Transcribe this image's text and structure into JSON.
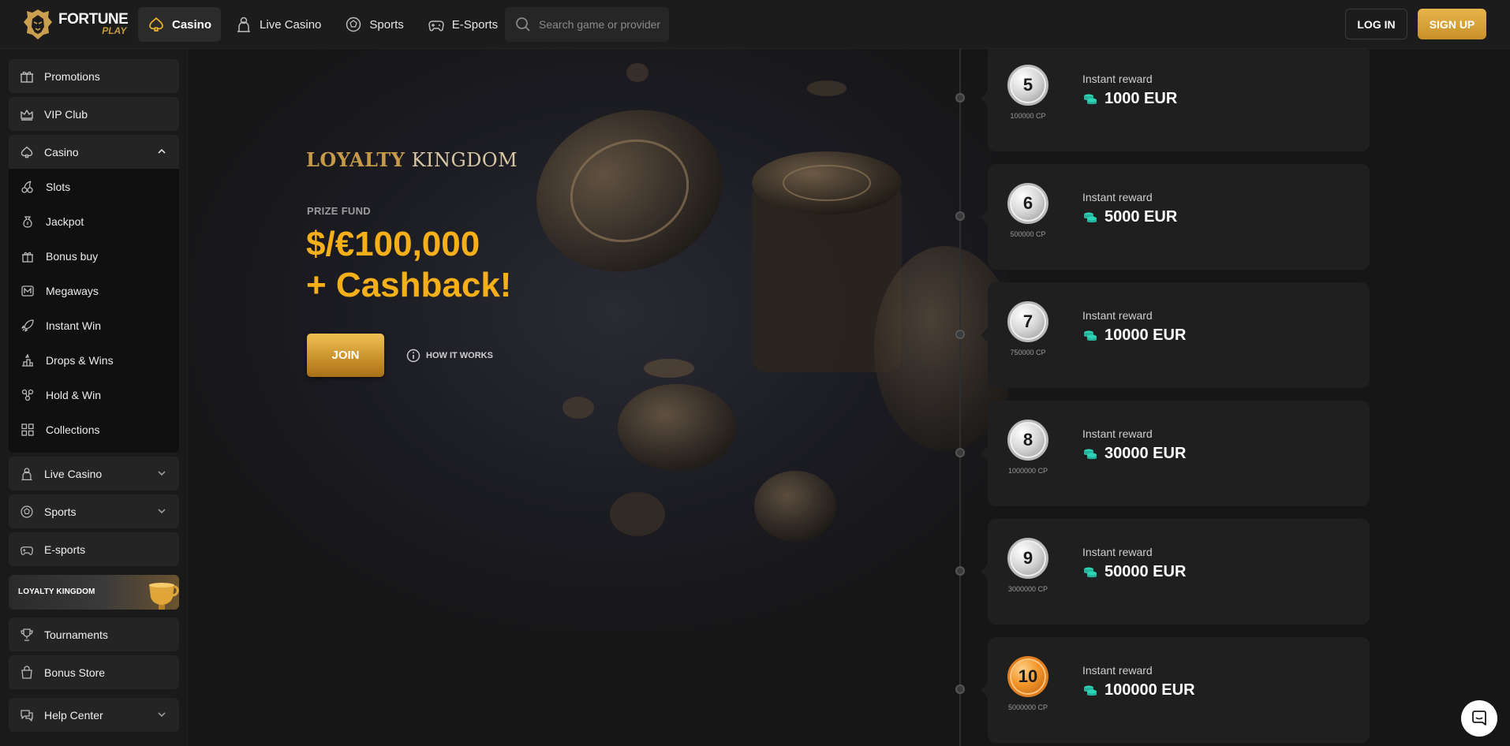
{
  "header": {
    "logo": {
      "line1": "FORTUNE",
      "line2": "PLAY",
      "icon": "lion-head-icon"
    },
    "nav": [
      {
        "label": "Casino",
        "icon": "spade-icon",
        "active": true
      },
      {
        "label": "Live Casino",
        "icon": "dealer-icon",
        "active": false
      },
      {
        "label": "Sports",
        "icon": "soccer-ball-icon",
        "active": false
      },
      {
        "label": "E-Sports",
        "icon": "gamepad-icon",
        "active": false
      }
    ],
    "search": {
      "placeholder": "Search game or provider",
      "value": ""
    },
    "login_label": "LOG IN",
    "signup_label": "SIGN UP"
  },
  "sidebar": {
    "items": [
      {
        "label": "Promotions",
        "icon": "gift-icon"
      },
      {
        "label": "VIP Club",
        "icon": "crown-icon"
      },
      {
        "label": "Casino",
        "icon": "spade-icon",
        "expanded": true
      }
    ],
    "casino_sub": [
      {
        "label": "Slots",
        "icon": "cherries-icon"
      },
      {
        "label": "Jackpot",
        "icon": "money-bag-icon"
      },
      {
        "label": "Bonus buy",
        "icon": "gift-box-icon"
      },
      {
        "label": "Megaways",
        "icon": "megaways-icon"
      },
      {
        "label": "Instant Win",
        "icon": "rocket-icon"
      },
      {
        "label": "Drops & Wins",
        "icon": "drops-icon"
      },
      {
        "label": "Hold & Win",
        "icon": "hold-win-icon"
      },
      {
        "label": "Collections",
        "icon": "grid-icon"
      }
    ],
    "items_after": [
      {
        "label": "Live Casino",
        "icon": "dealer-icon"
      },
      {
        "label": "Sports",
        "icon": "soccer-ball-icon"
      },
      {
        "label": "E-sports",
        "icon": "gamepad-icon"
      }
    ],
    "loyalty_label": "LOYALTY KINGDOM",
    "items_bottom": [
      {
        "label": "Tournaments",
        "icon": "trophy-icon"
      },
      {
        "label": "Bonus Store",
        "icon": "shopping-bag-icon"
      },
      {
        "label": "Help Center",
        "icon": "chat-help-icon"
      }
    ]
  },
  "hero": {
    "brand_part1": "LOYALTY",
    "brand_part2": "KINGDOM",
    "prize_label": "PRIZE FUND",
    "prize_line1": "$/€100,000",
    "prize_line2": "+ Cashback!",
    "join_label": "JOIN",
    "how_label": "HOW IT WORKS"
  },
  "levels": [
    {
      "level": "5",
      "cp": "100000 CP",
      "label": "Instant reward",
      "reward": "1000 EUR",
      "medal": "silver"
    },
    {
      "level": "6",
      "cp": "500000 CP",
      "label": "Instant reward",
      "reward": "5000 EUR",
      "medal": "silver"
    },
    {
      "level": "7",
      "cp": "750000 CP",
      "label": "Instant reward",
      "reward": "10000 EUR",
      "medal": "silver"
    },
    {
      "level": "8",
      "cp": "1000000 CP",
      "label": "Instant reward",
      "reward": "30000 EUR",
      "medal": "silver"
    },
    {
      "level": "9",
      "cp": "3000000 CP",
      "label": "Instant reward",
      "reward": "50000 EUR",
      "medal": "silver"
    },
    {
      "level": "10",
      "cp": "5000000 CP",
      "label": "Instant reward",
      "reward": "100000 EUR",
      "medal": "bronze"
    }
  ],
  "colors": {
    "accent_gold": "#f5b019",
    "coin_teal": "#2ed3b7",
    "bg": "#161616"
  }
}
